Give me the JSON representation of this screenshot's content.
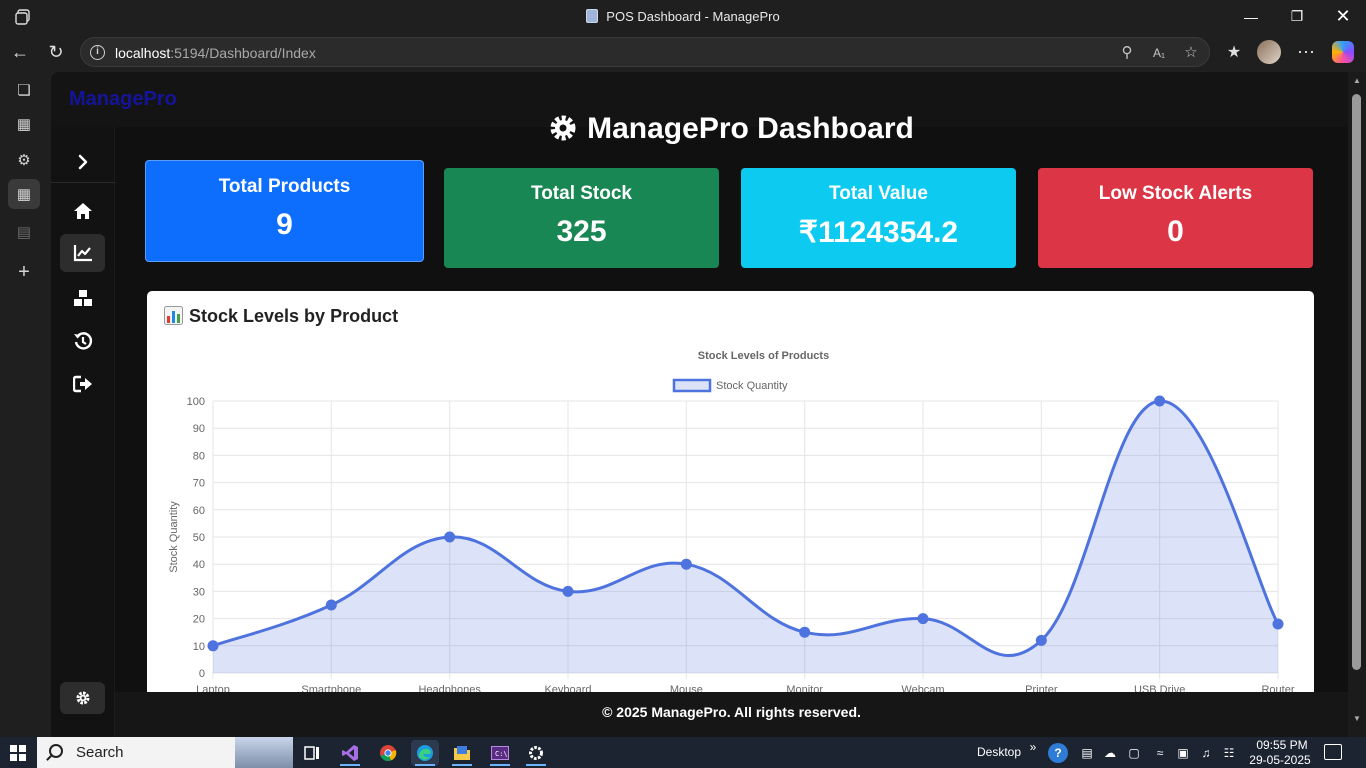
{
  "browser": {
    "window_title": "POS Dashboard - ManagePro",
    "url_host": "localhost",
    "url_rest": ":5194/Dashboard/Index"
  },
  "app": {
    "brand": "ManagePro",
    "page_title": "ManagePro Dashboard",
    "footer": "© 2025 ManagePro. All rights reserved.",
    "sidebar": {
      "items": [
        {
          "name": "home",
          "active": false
        },
        {
          "name": "chart",
          "active": true
        },
        {
          "name": "boxes",
          "active": false
        },
        {
          "name": "history",
          "active": false
        },
        {
          "name": "logout",
          "active": false
        }
      ]
    }
  },
  "cards": [
    {
      "label": "Total Products",
      "value": "9",
      "color": "#0d6efd"
    },
    {
      "label": "Total Stock",
      "value": "325",
      "color": "#198754"
    },
    {
      "label": "Total Value",
      "value": "₹1124354.2",
      "color": "#0dcaf0"
    },
    {
      "label": "Low Stock Alerts",
      "value": "0",
      "color": "#dc3545"
    }
  ],
  "chart_panel": {
    "heading": "Stock Levels by Product"
  },
  "chart_data": {
    "type": "area",
    "title": "Stock Levels of Products",
    "ylabel": "Stock Quantity",
    "xlabel": "",
    "ylim": [
      0,
      100
    ],
    "yticks": [
      0,
      10,
      20,
      30,
      40,
      50,
      60,
      70,
      80,
      90,
      100
    ],
    "categories": [
      "Laptop",
      "Smartphone",
      "Headphones",
      "Keyboard",
      "Mouse",
      "Monitor",
      "Webcam",
      "Printer",
      "USB Drive",
      "Router"
    ],
    "series": [
      {
        "name": "Stock Quantity",
        "values": [
          10,
          25,
          50,
          30,
          40,
          15,
          20,
          12,
          100,
          18
        ],
        "color": "#4e73df"
      }
    ],
    "legend_position": "top",
    "grid": true
  },
  "taskbar": {
    "search_label": "Search",
    "desktop_label": "Desktop",
    "time": "09:55 PM",
    "date": "29-05-2025"
  }
}
